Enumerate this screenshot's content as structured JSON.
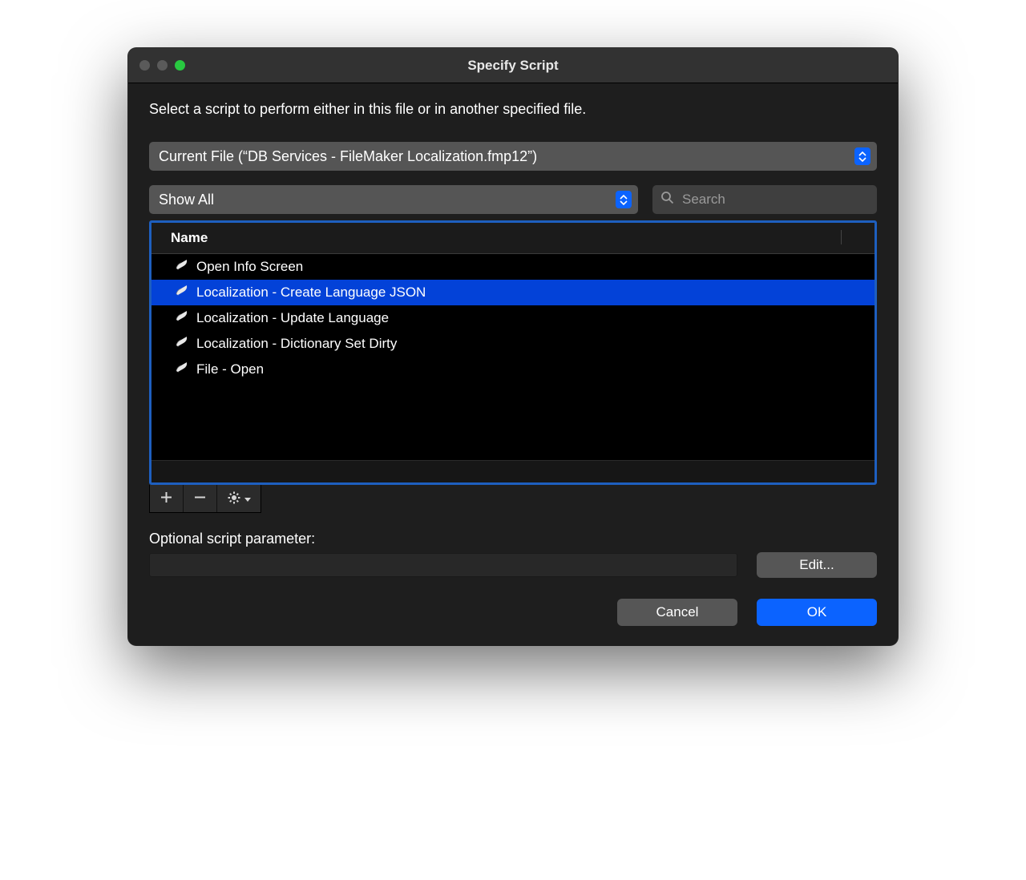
{
  "window": {
    "title": "Specify Script"
  },
  "instruction": "Select a script to perform either in this file or in another specified file.",
  "file_select": {
    "label": "Current File (“DB Services - FileMaker Localization.fmp12”)"
  },
  "filter": {
    "label": "Show All"
  },
  "search": {
    "placeholder": "Search",
    "value": ""
  },
  "list": {
    "header": "Name",
    "selected_index": 1,
    "items": [
      {
        "label": "Open Info Screen"
      },
      {
        "label": "Localization - Create Language JSON"
      },
      {
        "label": "Localization - Update Language"
      },
      {
        "label": "Localization - Dictionary Set Dirty"
      },
      {
        "label": "File - Open"
      }
    ]
  },
  "param": {
    "label": "Optional script parameter:",
    "value": "",
    "edit_label": "Edit..."
  },
  "buttons": {
    "cancel": "Cancel",
    "ok": "OK"
  }
}
